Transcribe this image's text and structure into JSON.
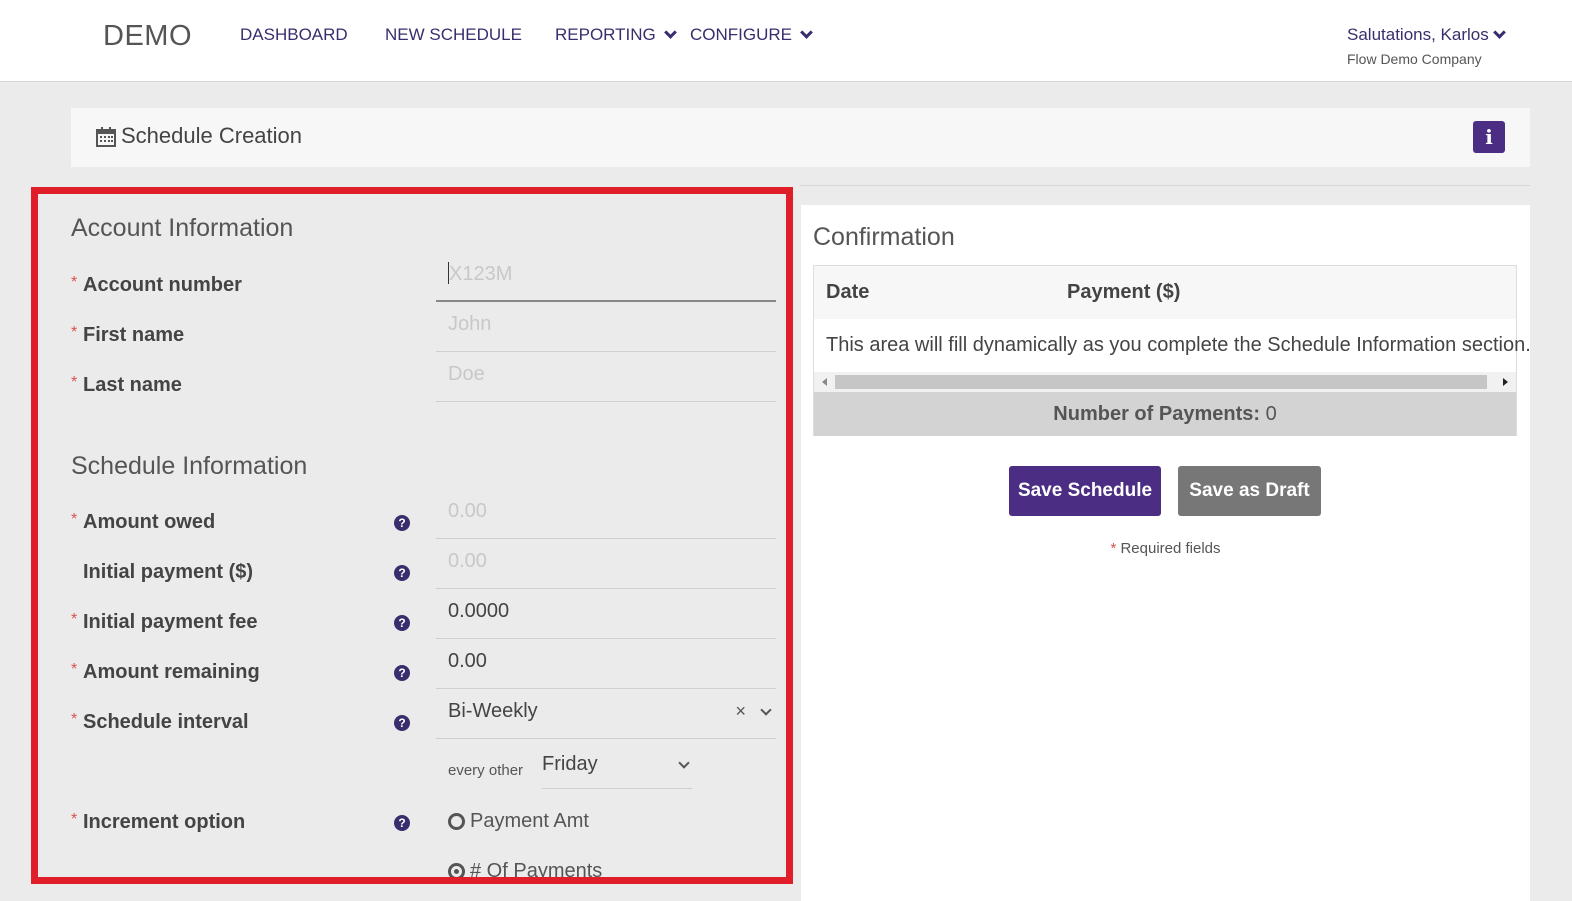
{
  "nav": {
    "brand": "DEMO",
    "items": [
      "DASHBOARD",
      "NEW SCHEDULE",
      "REPORTING",
      "CONFIGURE"
    ],
    "user": "Salutations, Karlos",
    "company": "Flow Demo Company"
  },
  "header": {
    "title": "Schedule Creation",
    "info_icon": "i"
  },
  "account": {
    "title": "Account Information",
    "account_number": {
      "label": "Account number",
      "placeholder": "X123M"
    },
    "first_name": {
      "label": "First name",
      "placeholder": "John"
    },
    "last_name": {
      "label": "Last name",
      "placeholder": "Doe"
    }
  },
  "schedule": {
    "title": "Schedule Information",
    "amount_owed": {
      "label": "Amount owed",
      "placeholder": "0.00"
    },
    "initial_payment": {
      "label": "Initial payment ($)",
      "placeholder": "0.00"
    },
    "initial_fee": {
      "label": "Initial payment fee",
      "value": "0.0000"
    },
    "amount_remaining": {
      "label": "Amount remaining",
      "value": "0.00"
    },
    "interval": {
      "label": "Schedule interval",
      "value": "Bi-Weekly",
      "clear": "×"
    },
    "every_other": {
      "label": "every other",
      "value": "Friday"
    },
    "increment": {
      "label": "Increment option",
      "options": [
        "Payment Amt",
        "# Of Payments"
      ],
      "selected": "# Of Payments"
    },
    "required_mark": "*",
    "help_icon": "?"
  },
  "confirmation": {
    "title": "Confirmation",
    "columns": [
      "Date",
      "Payment ($)"
    ],
    "message": "This area will fill dynamically as you complete the Schedule Information section.",
    "count_label": "Number of Payments:",
    "count_value": "0",
    "save_label": "Save Schedule",
    "draft_label": "Save as Draft",
    "required_note": "Required fields"
  },
  "colors": {
    "accent": "#4b2d84",
    "nav_text": "#3a2d6e",
    "highlight_border": "#e01e29",
    "required": "#d9534f"
  }
}
